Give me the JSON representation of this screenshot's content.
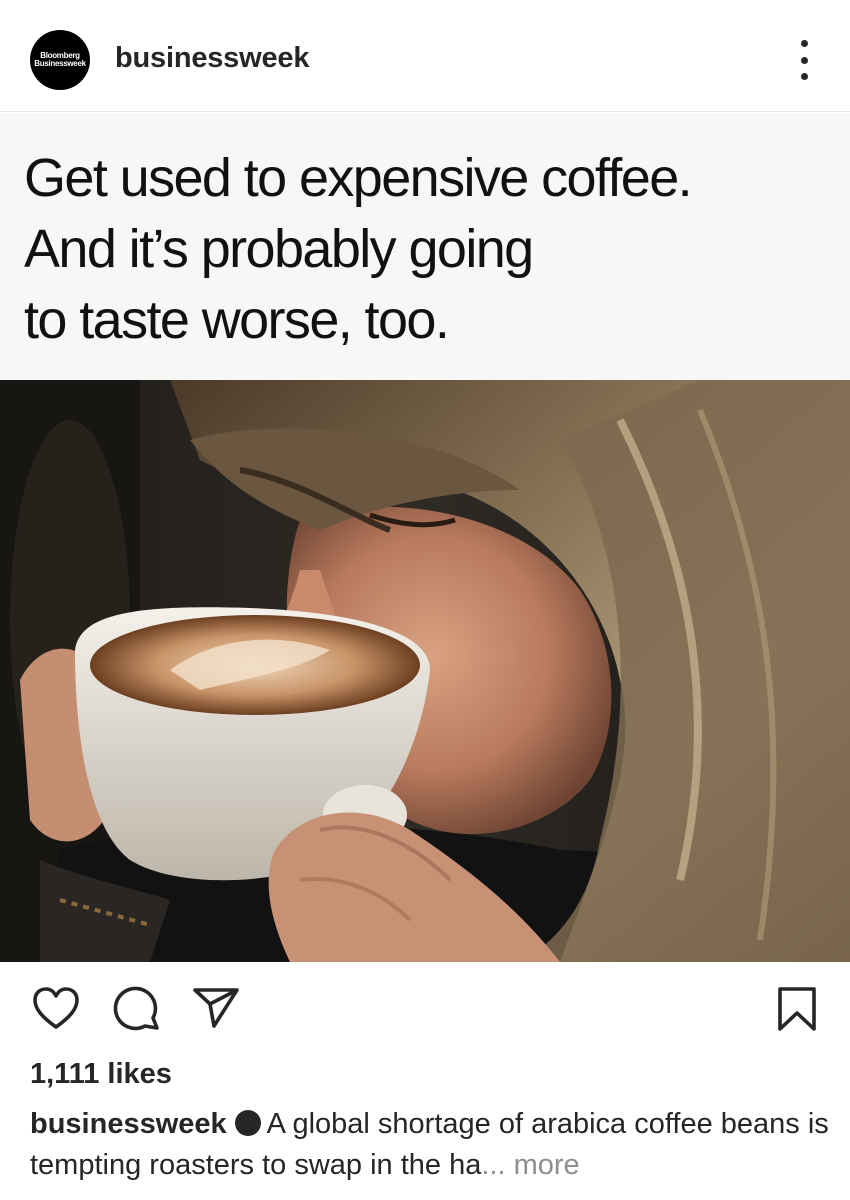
{
  "post": {
    "author": {
      "avatar_text_line1": "Bloomberg",
      "avatar_text_line2": "Businessweek",
      "username": "businessweek"
    },
    "headline": "Get used to expensive coffee.\nAnd it’s probably going\nto taste worse, too.",
    "image": {
      "description_icon": "photo-woman-drinking-cappuccino"
    },
    "actions": {
      "like_icon": "heart-icon",
      "comment_icon": "comment-icon",
      "share_icon": "paper-plane-icon",
      "save_icon": "bookmark-icon"
    },
    "likes_text": "1,111 likes",
    "caption": {
      "username": "businessweek",
      "text": "A global shortage of arabica coffee beans is tempting roasters to swap in the ha",
      "ellipsis": "...",
      "more_label": "more"
    }
  },
  "colors": {
    "text": "#262626",
    "muted": "#8e8e8e",
    "headline_bg": "#f7f7f7",
    "divider": "#e6e6e6"
  }
}
